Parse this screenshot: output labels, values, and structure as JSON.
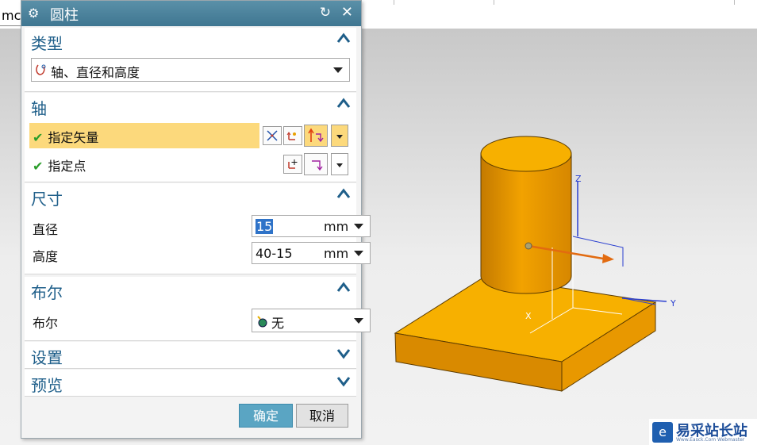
{
  "topbar": {
    "fragment": "mc"
  },
  "dialog": {
    "title": "圆柱",
    "sections": {
      "type": {
        "label": "类型",
        "combo_value": "轴、直径和高度"
      },
      "axis": {
        "label": "轴",
        "vector_label": "指定矢量",
        "point_label": "指定点"
      },
      "size": {
        "label": "尺寸",
        "diameter_label": "直径",
        "diameter_value": "15",
        "diameter_unit": "mm",
        "height_label": "高度",
        "height_value": "40-15",
        "height_unit": "mm"
      },
      "boolean": {
        "label": "布尔",
        "row_label": "布尔",
        "value": "无"
      },
      "settings": {
        "label": "设置"
      },
      "preview": {
        "label": "预览"
      }
    },
    "buttons": {
      "ok": "确定",
      "cancel": "取消"
    }
  },
  "scene": {
    "axis_z": "Z",
    "axis_y": "Y",
    "axis_x": "X",
    "colors": {
      "solid": "#f5a300",
      "solid_dark": "#c97f00",
      "highlight_row": "#fcd97c",
      "title_bar": "#4a85a0"
    }
  },
  "watermark": {
    "brand": "易采站长站",
    "sub": "Www.Easck.Com Webmaster"
  }
}
